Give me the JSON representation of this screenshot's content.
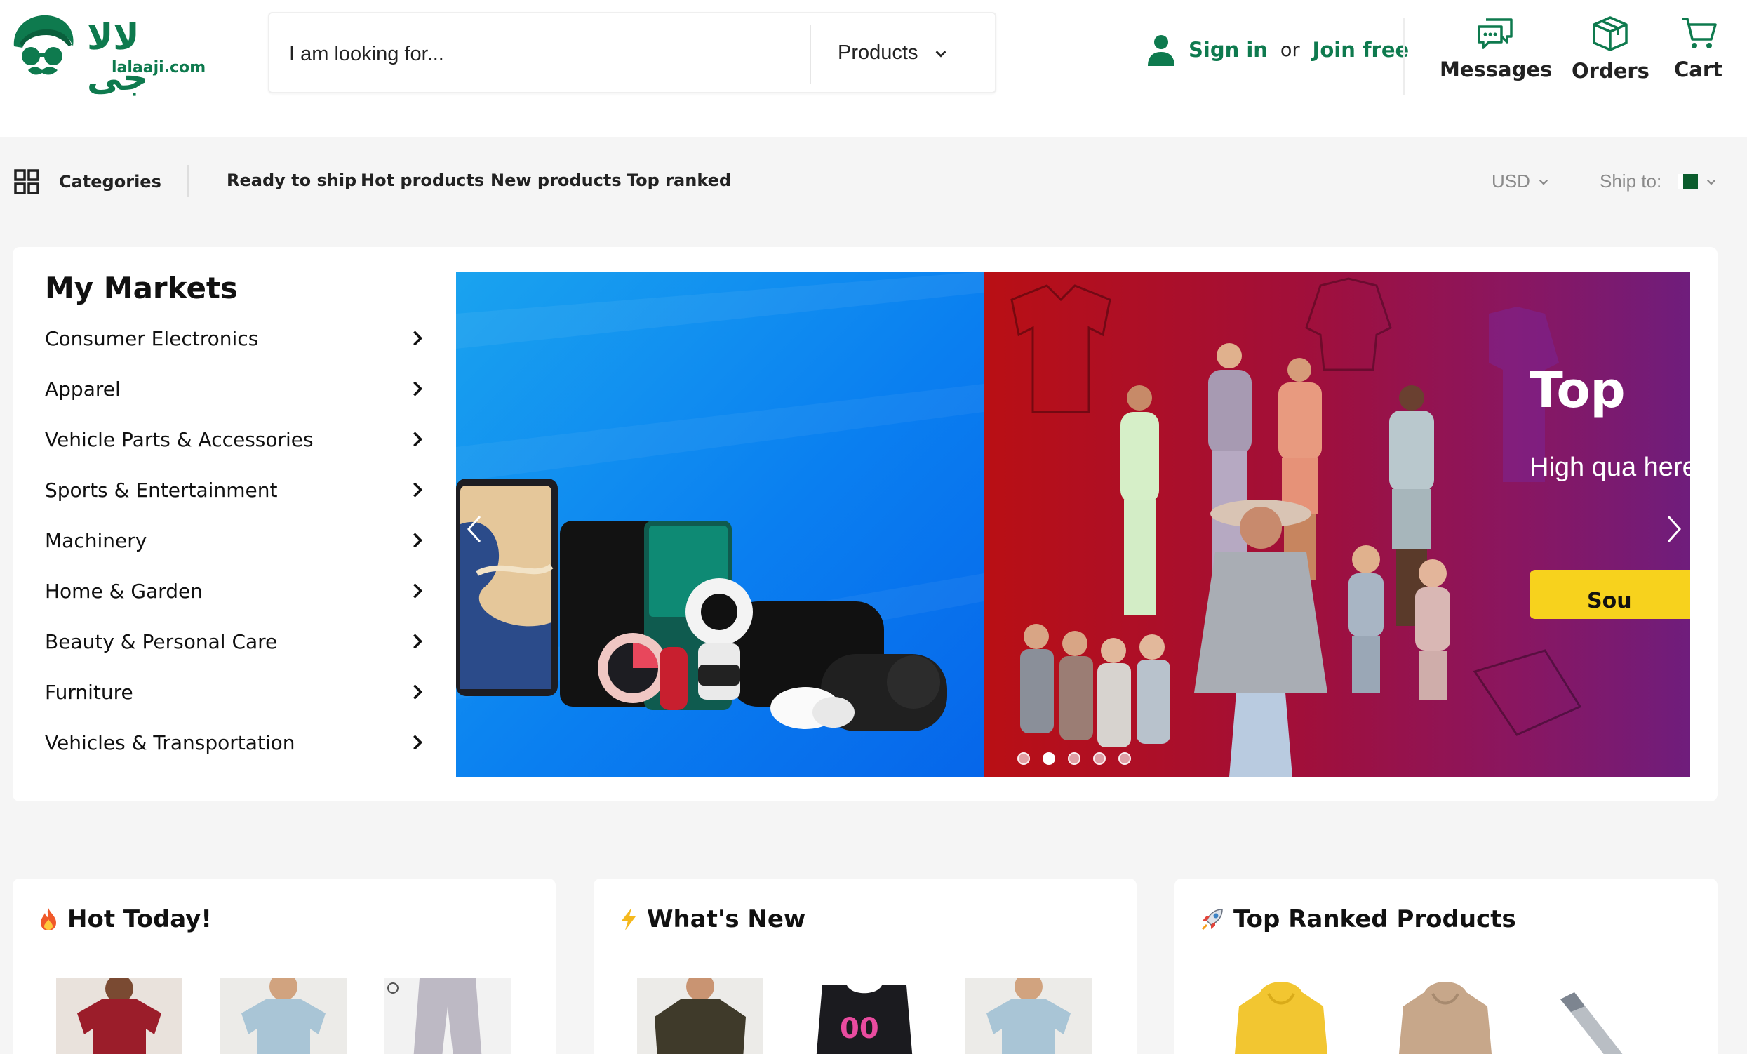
{
  "logo": {
    "arabic": "لالا جی",
    "domain": "lalaaji.com"
  },
  "search": {
    "placeholder": "I am looking for...",
    "category": "Products"
  },
  "account": {
    "sign_in": "Sign in",
    "or": "or",
    "join": "Join free"
  },
  "actions": [
    {
      "label": "Messages",
      "icon": "messages-icon"
    },
    {
      "label": "Orders",
      "icon": "orders-icon"
    },
    {
      "label": "Cart",
      "icon": "cart-icon"
    }
  ],
  "nav": {
    "categories": "Categories",
    "links": [
      "Ready to ship",
      "Hot products",
      "New products",
      "Top ranked"
    ],
    "currency": "USD",
    "ship_to": "Ship to:"
  },
  "markets": {
    "title": "My Markets",
    "items": [
      "Consumer Electronics",
      "Apparel",
      "Vehicle Parts & Accessories",
      "Sports & Entertainment",
      "Machinery",
      "Home & Garden",
      "Beauty & Personal Care",
      "Furniture",
      "Vehicles & Transportation"
    ]
  },
  "banner": {
    "headline": "Top",
    "subtext": "High qua here",
    "button": "Sou",
    "slide_count": 5,
    "active_slide": 1
  },
  "sections": [
    {
      "title": "Hot Today!",
      "icon": "fire-icon"
    },
    {
      "title": "What's New",
      "icon": "lightning-icon"
    },
    {
      "title": "Top Ranked Products",
      "icon": "rocket-icon"
    }
  ],
  "colors": {
    "brand": "#0e7a4e",
    "accent": "#f7d21d"
  }
}
